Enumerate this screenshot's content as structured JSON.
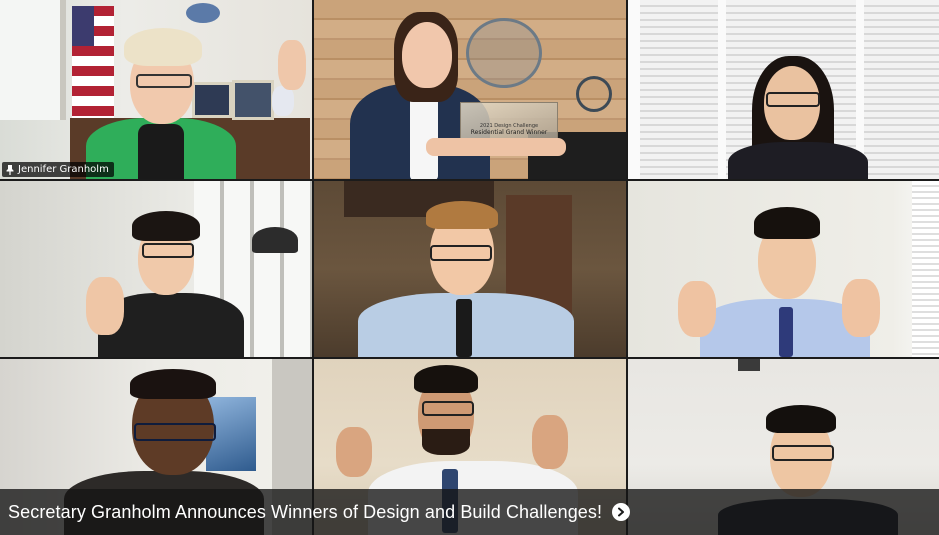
{
  "participants": [
    {
      "name": "Jennifer Granholm",
      "show_label": true,
      "speaking": true
    },
    {
      "name": "",
      "show_label": false,
      "speaking": false
    },
    {
      "name": "",
      "show_label": false,
      "speaking": false
    },
    {
      "name": "",
      "show_label": false,
      "speaking": false
    },
    {
      "name": "",
      "show_label": false,
      "speaking": false
    },
    {
      "name": "",
      "show_label": false,
      "speaking": false
    },
    {
      "name": "",
      "show_label": false,
      "speaking": false
    },
    {
      "name": "",
      "show_label": false,
      "speaking": false
    },
    {
      "name": "",
      "show_label": false,
      "speaking": false
    }
  ],
  "award_plaque": {
    "line1": "2021 Design Challenge",
    "line2": "Residential Grand Winner"
  },
  "caption": {
    "text": "Secretary Granholm Announces Winners of Design and Build Challenges!",
    "icon": "chevron-right-circle-icon"
  },
  "colors": {
    "speaking_border": "#d7e64b",
    "caption_bg": "#141414"
  }
}
